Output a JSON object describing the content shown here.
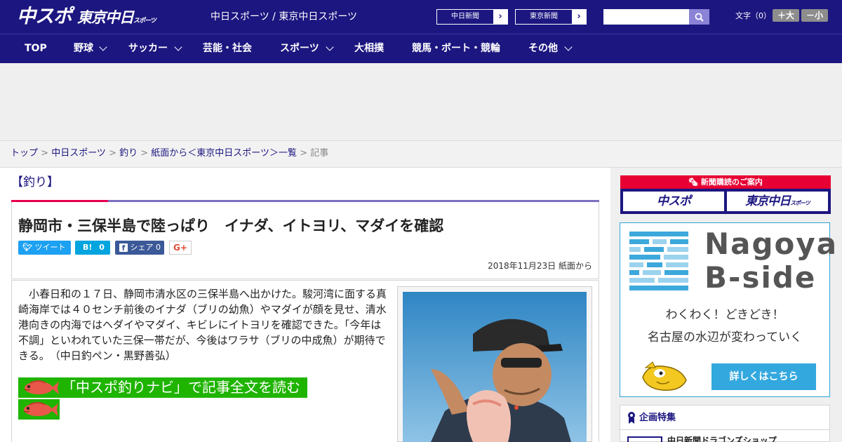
{
  "header": {
    "logo_chunichi": "中スポ",
    "logo_tokyo": "東京中日",
    "logo_tokyo_small": "スポーツ",
    "site_names": "中日スポーツ / 東京中日スポーツ",
    "paper_links": [
      {
        "label": "中日新聞"
      },
      {
        "label": "東京新聞"
      }
    ],
    "search_placeholder": "",
    "font_size_label": "文字（0）",
    "font_larger": "＋大",
    "font_smaller": "－小"
  },
  "nav": {
    "items": [
      {
        "label": "TOP"
      },
      {
        "label": "野球"
      },
      {
        "label": "サッカー"
      },
      {
        "label": "芸能・社会"
      },
      {
        "label": "スポーツ"
      },
      {
        "label": "大相撲"
      },
      {
        "label": "競馬・ボート・競輪"
      },
      {
        "label": "その他"
      }
    ]
  },
  "breadcrumb": {
    "links": [
      "トップ",
      "中日スポーツ",
      "釣り",
      "紙面から＜東京中日スポーツ＞一覧"
    ],
    "separator": " > ",
    "current": "記事"
  },
  "article": {
    "category": "【釣り】",
    "headline": "静岡市・三保半島で陸っぱり　イナダ、イトヨリ、マダイを確認",
    "share": {
      "tweet": "ツイート",
      "hatena_label": "B!",
      "hatena_count": "0",
      "facebook": "シェア",
      "facebook_count": "0",
      "gplus": "G+"
    },
    "date": "2018年11月23日 紙面から",
    "body": "小春日和の１７日、静岡市清水区の三保半島へ出かけた。駿河湾に面する真崎海岸では４０センチ前後のイナダ（ブリの幼魚）やマダイが顔を見せ、清水港向きの内海ではヘダイやマダイ、キビレにイトヨリを確認できた。「今年は不調」といわれていた三保一帯だが、今後はワラサ（ブリの中成魚）が期待できる。　（中日釣ペン・黒野善弘）",
    "navi_link": "「中スポ釣りナビ」で記事全文を読む"
  },
  "sidebar": {
    "subscribe_head": "新聞購読のご案内",
    "subscribe_chunichi": "中スポ",
    "subscribe_tokyo": "東京中日",
    "subscribe_tokyo_small": "スポーツ",
    "bside_title1": "Nagoya",
    "bside_title2": "B-side",
    "bside_tag1": "わくわく！どきどき！",
    "bside_tag2": "名古屋の水辺が変わっていく",
    "bside_button": "詳しくはこちら",
    "special_title": "企画特集",
    "special_item": "中日新聞ドラゴンズショップ"
  },
  "colors": {
    "brand_navy": "#1c1680",
    "accent_red": "#e5004f",
    "link_green": "#1fb400",
    "bside_blue": "#33a8de"
  }
}
